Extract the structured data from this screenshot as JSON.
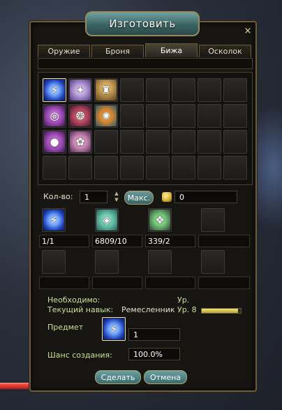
{
  "window": {
    "title": "Изготовить",
    "close_glyph": "×"
  },
  "tabs": [
    {
      "label": "Оружие",
      "active": false
    },
    {
      "label": "Броня",
      "active": false
    },
    {
      "label": "Бижа",
      "active": true
    },
    {
      "label": "Осколок",
      "active": false
    }
  ],
  "recipe_grid": {
    "rows": 4,
    "cols": 8,
    "items": [
      {
        "icon": "blue-lightning-icon",
        "selected": true
      },
      {
        "icon": "lavender-necklace-icon",
        "selected": false
      },
      {
        "icon": "gold-pedestal-icon",
        "selected": false
      },
      {
        "icon": "purple-ring-icon",
        "selected": false
      },
      {
        "icon": "red-ring-icon",
        "selected": false
      },
      {
        "icon": "orange-amulet-icon",
        "selected": false
      },
      {
        "icon": "purple-orb-icon",
        "selected": false
      },
      {
        "icon": "pink-bracelet-icon",
        "selected": false
      }
    ]
  },
  "quantity": {
    "label": "Кол-во:",
    "value": "1",
    "spin_up": "▲",
    "spin_down": "▼",
    "max_label": "Макс.",
    "gold_value": "0"
  },
  "materials": [
    {
      "icon": "blue-lightning-icon",
      "count": "1/1"
    },
    {
      "icon": "teal-crystal-icon",
      "count": "6809/10"
    },
    {
      "icon": "green-gem-icon",
      "count": "339/2"
    },
    {
      "icon": "",
      "count": ""
    }
  ],
  "info": {
    "required_label": "Необходимо:",
    "level_label": "Ур.",
    "level_required": "",
    "current_skill_label": "Текущий навык:",
    "skill_name": "Ремесленник",
    "skill_level_label": "Ур. 8",
    "skill_progress": 0.92,
    "item_label": "Предмет",
    "item_icon": "blue-lightning-icon",
    "item_qty": "1",
    "chance_label": "Шанс создания:",
    "chance_value": "100.0%"
  },
  "buttons": {
    "make": "Сделать",
    "cancel": "Отмена"
  }
}
